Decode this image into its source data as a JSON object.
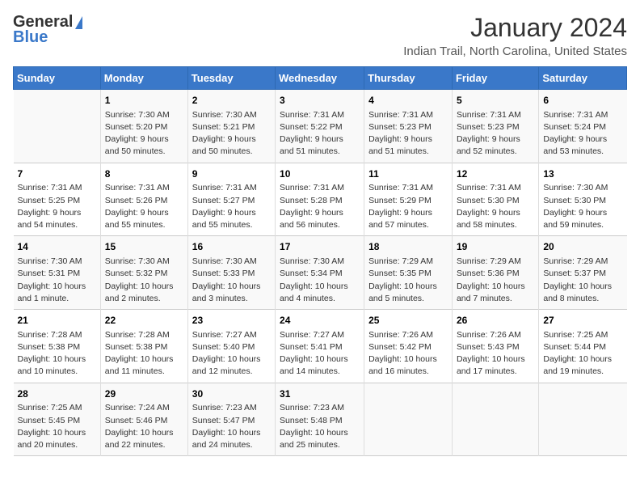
{
  "header": {
    "logo_general": "General",
    "logo_blue": "Blue",
    "title": "January 2024",
    "subtitle": "Indian Trail, North Carolina, United States"
  },
  "columns": [
    "Sunday",
    "Monday",
    "Tuesday",
    "Wednesday",
    "Thursday",
    "Friday",
    "Saturday"
  ],
  "weeks": [
    [
      {
        "day": "",
        "info": ""
      },
      {
        "day": "1",
        "info": "Sunrise: 7:30 AM\nSunset: 5:20 PM\nDaylight: 9 hours\nand 50 minutes."
      },
      {
        "day": "2",
        "info": "Sunrise: 7:30 AM\nSunset: 5:21 PM\nDaylight: 9 hours\nand 50 minutes."
      },
      {
        "day": "3",
        "info": "Sunrise: 7:31 AM\nSunset: 5:22 PM\nDaylight: 9 hours\nand 51 minutes."
      },
      {
        "day": "4",
        "info": "Sunrise: 7:31 AM\nSunset: 5:23 PM\nDaylight: 9 hours\nand 51 minutes."
      },
      {
        "day": "5",
        "info": "Sunrise: 7:31 AM\nSunset: 5:23 PM\nDaylight: 9 hours\nand 52 minutes."
      },
      {
        "day": "6",
        "info": "Sunrise: 7:31 AM\nSunset: 5:24 PM\nDaylight: 9 hours\nand 53 minutes."
      }
    ],
    [
      {
        "day": "7",
        "info": "Sunrise: 7:31 AM\nSunset: 5:25 PM\nDaylight: 9 hours\nand 54 minutes."
      },
      {
        "day": "8",
        "info": "Sunrise: 7:31 AM\nSunset: 5:26 PM\nDaylight: 9 hours\nand 55 minutes."
      },
      {
        "day": "9",
        "info": "Sunrise: 7:31 AM\nSunset: 5:27 PM\nDaylight: 9 hours\nand 55 minutes."
      },
      {
        "day": "10",
        "info": "Sunrise: 7:31 AM\nSunset: 5:28 PM\nDaylight: 9 hours\nand 56 minutes."
      },
      {
        "day": "11",
        "info": "Sunrise: 7:31 AM\nSunset: 5:29 PM\nDaylight: 9 hours\nand 57 minutes."
      },
      {
        "day": "12",
        "info": "Sunrise: 7:31 AM\nSunset: 5:30 PM\nDaylight: 9 hours\nand 58 minutes."
      },
      {
        "day": "13",
        "info": "Sunrise: 7:30 AM\nSunset: 5:30 PM\nDaylight: 9 hours\nand 59 minutes."
      }
    ],
    [
      {
        "day": "14",
        "info": "Sunrise: 7:30 AM\nSunset: 5:31 PM\nDaylight: 10 hours\nand 1 minute."
      },
      {
        "day": "15",
        "info": "Sunrise: 7:30 AM\nSunset: 5:32 PM\nDaylight: 10 hours\nand 2 minutes."
      },
      {
        "day": "16",
        "info": "Sunrise: 7:30 AM\nSunset: 5:33 PM\nDaylight: 10 hours\nand 3 minutes."
      },
      {
        "day": "17",
        "info": "Sunrise: 7:30 AM\nSunset: 5:34 PM\nDaylight: 10 hours\nand 4 minutes."
      },
      {
        "day": "18",
        "info": "Sunrise: 7:29 AM\nSunset: 5:35 PM\nDaylight: 10 hours\nand 5 minutes."
      },
      {
        "day": "19",
        "info": "Sunrise: 7:29 AM\nSunset: 5:36 PM\nDaylight: 10 hours\nand 7 minutes."
      },
      {
        "day": "20",
        "info": "Sunrise: 7:29 AM\nSunset: 5:37 PM\nDaylight: 10 hours\nand 8 minutes."
      }
    ],
    [
      {
        "day": "21",
        "info": "Sunrise: 7:28 AM\nSunset: 5:38 PM\nDaylight: 10 hours\nand 10 minutes."
      },
      {
        "day": "22",
        "info": "Sunrise: 7:28 AM\nSunset: 5:38 PM\nDaylight: 10 hours\nand 11 minutes."
      },
      {
        "day": "23",
        "info": "Sunrise: 7:27 AM\nSunset: 5:40 PM\nDaylight: 10 hours\nand 12 minutes."
      },
      {
        "day": "24",
        "info": "Sunrise: 7:27 AM\nSunset: 5:41 PM\nDaylight: 10 hours\nand 14 minutes."
      },
      {
        "day": "25",
        "info": "Sunrise: 7:26 AM\nSunset: 5:42 PM\nDaylight: 10 hours\nand 16 minutes."
      },
      {
        "day": "26",
        "info": "Sunrise: 7:26 AM\nSunset: 5:43 PM\nDaylight: 10 hours\nand 17 minutes."
      },
      {
        "day": "27",
        "info": "Sunrise: 7:25 AM\nSunset: 5:44 PM\nDaylight: 10 hours\nand 19 minutes."
      }
    ],
    [
      {
        "day": "28",
        "info": "Sunrise: 7:25 AM\nSunset: 5:45 PM\nDaylight: 10 hours\nand 20 minutes."
      },
      {
        "day": "29",
        "info": "Sunrise: 7:24 AM\nSunset: 5:46 PM\nDaylight: 10 hours\nand 22 minutes."
      },
      {
        "day": "30",
        "info": "Sunrise: 7:23 AM\nSunset: 5:47 PM\nDaylight: 10 hours\nand 24 minutes."
      },
      {
        "day": "31",
        "info": "Sunrise: 7:23 AM\nSunset: 5:48 PM\nDaylight: 10 hours\nand 25 minutes."
      },
      {
        "day": "",
        "info": ""
      },
      {
        "day": "",
        "info": ""
      },
      {
        "day": "",
        "info": ""
      }
    ]
  ]
}
